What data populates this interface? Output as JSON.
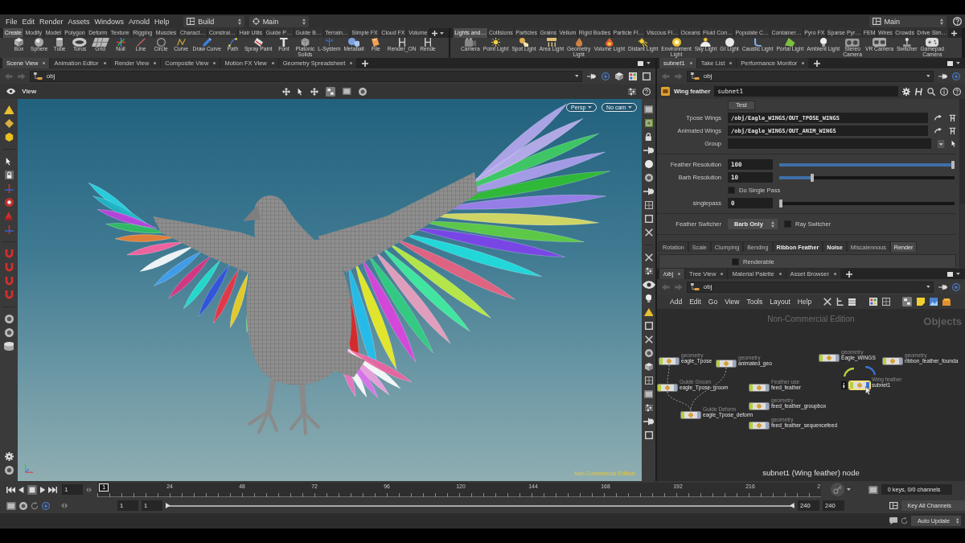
{
  "menu_bar": {
    "items": [
      "File",
      "Edit",
      "Render",
      "Assets",
      "Windows",
      "Arnold",
      "Help"
    ],
    "desktop": "Build",
    "pane_link": "Main",
    "right_link": "Main"
  },
  "shelves": [
    {
      "tabs": [
        {
          "label": "Create",
          "selected": true
        },
        {
          "label": "Modify",
          "selected": false
        },
        {
          "label": "Model",
          "selected": false
        },
        {
          "label": "Polygon",
          "selected": false
        },
        {
          "label": "Deform",
          "selected": false
        },
        {
          "label": "Texture",
          "selected": false
        },
        {
          "label": "Rigging",
          "selected": false
        },
        {
          "label": "Muscles",
          "selected": false
        },
        {
          "label": "Charact…",
          "selected": false
        },
        {
          "label": "Constrai…",
          "selected": false
        },
        {
          "label": "Hair Utils",
          "selected": false
        },
        {
          "label": "Guide P…",
          "selected": false
        },
        {
          "label": "Guide B…",
          "selected": false
        },
        {
          "label": "Terrain…",
          "selected": false
        },
        {
          "label": "Simple FX",
          "selected": false
        },
        {
          "label": "Cloud FX",
          "selected": false
        },
        {
          "label": "Volume",
          "selected": false
        }
      ],
      "tools": [
        "Box",
        "Sphere",
        "Tube",
        "Torus",
        "Grid",
        "Null",
        "Line",
        "Circle",
        "Curve",
        "Draw Curve",
        "Path",
        "Spray Paint",
        "Font",
        "Platonic\nSolids",
        "L-System",
        "Metaball",
        "File",
        "Render_ON",
        "Rende"
      ]
    },
    {
      "tabs": [
        {
          "label": "Lights and…",
          "selected": true
        },
        {
          "label": "Collisions",
          "selected": false
        },
        {
          "label": "Particles",
          "selected": false
        },
        {
          "label": "Grains",
          "selected": false
        },
        {
          "label": "Vellum",
          "selected": false
        },
        {
          "label": "Rigid Bodies",
          "selected": false
        },
        {
          "label": "Particle Fl…",
          "selected": false
        },
        {
          "label": "Viscous Fl…",
          "selected": false
        },
        {
          "label": "Oceans",
          "selected": false
        },
        {
          "label": "Fluid Con…",
          "selected": false
        },
        {
          "label": "Populate C…",
          "selected": false
        },
        {
          "label": "Container…",
          "selected": false
        },
        {
          "label": "Pyro FX",
          "selected": false
        },
        {
          "label": "Sparse Pyr…",
          "selected": false
        },
        {
          "label": "FEM",
          "selected": false
        },
        {
          "label": "Wires",
          "selected": false
        },
        {
          "label": "Crowds",
          "selected": false
        },
        {
          "label": "Drive Sim…",
          "selected": false
        }
      ],
      "tools": [
        "Camera",
        "Point Light",
        "Spot Light",
        "Area Light",
        "Geometry\nLight",
        "Volume Light",
        "Distant Light",
        "Environment\nLight",
        "Sky Light",
        "GI Light",
        "Caustic Light",
        "Portal Light",
        "Ambient Light",
        "Stereo\nCamera",
        "VR Camera",
        "Switcher",
        "Gamepad\nCamera"
      ]
    }
  ],
  "scene_pane": {
    "tabs": [
      {
        "label": "Scene View",
        "selected": true
      },
      {
        "label": "Animation Editor",
        "selected": false
      },
      {
        "label": "Render View",
        "selected": false
      },
      {
        "label": "Composite View",
        "selected": false
      },
      {
        "label": "Motion FX View",
        "selected": false
      },
      {
        "label": "Geometry Spreadsheet",
        "selected": false
      }
    ],
    "path": "obj",
    "viewer_title": "View",
    "camera_menus": [
      "Persp",
      "No cam"
    ],
    "edition_label": "Non-Commercial Edition"
  },
  "parameter_pane": {
    "tabs": [
      {
        "label": "subnet1",
        "selected": true
      },
      {
        "label": "Take List",
        "selected": false
      },
      {
        "label": "Performance Monitor",
        "selected": false
      }
    ],
    "path": "obj",
    "node_type": "Wing feather",
    "node_name": "subnet1",
    "parameters": [
      {
        "kind": "button",
        "label": "Test"
      },
      {
        "kind": "path",
        "label": "Tpose Wings",
        "value": "/obj/Eagle_WINGS/OUT_TPOSE_WINGS"
      },
      {
        "kind": "path",
        "label": "Animated Wings",
        "value": "/obj/Eagle_WINGS/OUT_ANIM_WINGS"
      },
      {
        "kind": "group",
        "label": "Group"
      },
      {
        "kind": "separator"
      },
      {
        "kind": "slider",
        "label": "Feather Resolution",
        "value": "100",
        "level": 1
      },
      {
        "kind": "slider",
        "label": "Barb Resolution",
        "value": "10",
        "level": 0.18
      },
      {
        "kind": "toggle",
        "label": "Do Single Pass",
        "checked": false
      },
      {
        "kind": "slider",
        "label": "singlepass",
        "value": "0",
        "level": 0
      },
      {
        "kind": "separator"
      },
      {
        "kind": "menu",
        "label": "Feather Switcher",
        "value": "Barb Only",
        "toggle": {
          "label": "Ray Switcher",
          "checked": false
        }
      },
      {
        "kind": "separator"
      }
    ],
    "folder_tabs": [
      {
        "label": "Rotation",
        "selected": false,
        "modified": false
      },
      {
        "label": "Scale",
        "selected": false,
        "modified": false
      },
      {
        "label": "Clumping",
        "selected": false,
        "modified": false
      },
      {
        "label": "Bending",
        "selected": false,
        "modified": false
      },
      {
        "label": "Ribbon Feather",
        "selected": false,
        "modified": true
      },
      {
        "label": "Noise",
        "selected": false,
        "modified": true
      },
      {
        "label": "Miscalennous",
        "selected": false,
        "modified": false
      },
      {
        "label": "Render",
        "selected": true,
        "modified": false
      }
    ],
    "folder_content": {
      "label": "Renderable",
      "checked": false
    }
  },
  "network_pane": {
    "tabs": [
      {
        "label": "/obj",
        "selected": true
      },
      {
        "label": "Tree View",
        "selected": false
      },
      {
        "label": "Material Palette",
        "selected": false
      },
      {
        "label": "Asset Browser",
        "selected": false
      }
    ],
    "path": "obj",
    "menu": [
      "Add",
      "Edit",
      "Go",
      "View",
      "Tools",
      "Layout",
      "Help"
    ],
    "watermark": "Non-Commercial Edition",
    "context": "Objects",
    "nodes": [
      {
        "type": "geometry",
        "name": "eagle_Tpose",
        "selected": false
      },
      {
        "type": "geometry",
        "name": "animated_geo",
        "selected": false
      },
      {
        "type": "geometry",
        "name": "Eagle_WINGS",
        "selected": false
      },
      {
        "type": "geometry",
        "name": "ribbon_feather_founda",
        "selected": false
      },
      {
        "type": "Guide Groom",
        "name": "eagle_Tpose_groom",
        "selected": false
      },
      {
        "type": "Feather use",
        "name": "feed_feather",
        "selected": false
      },
      {
        "type": "geometry",
        "name": "feed_feather_groupbox",
        "selected": false
      },
      {
        "type": "geometry",
        "name": "feed_feather_sequencefeed",
        "selected": false
      },
      {
        "type": "Guide Deform",
        "name": "eagle_Tpose_deform",
        "selected": false
      },
      {
        "type": "Wing feather",
        "name": "subnet1",
        "selected": true
      }
    ],
    "caption": "subnet1 (Wing feather) node"
  },
  "timeline": {
    "frame": "1",
    "marker": "1",
    "ruler_labels": [
      "24",
      "48",
      "72",
      "96",
      "120",
      "144",
      "168",
      "192",
      "216",
      "2"
    ],
    "range_start": "1",
    "playback_start": "1",
    "range_bar": {
      "level": 1
    },
    "playback_end": "240",
    "range_end": "240",
    "keys_status": "0 keys, 0/0 channels",
    "key_menu": "Key All Channels",
    "update_mode": "Auto Update"
  }
}
